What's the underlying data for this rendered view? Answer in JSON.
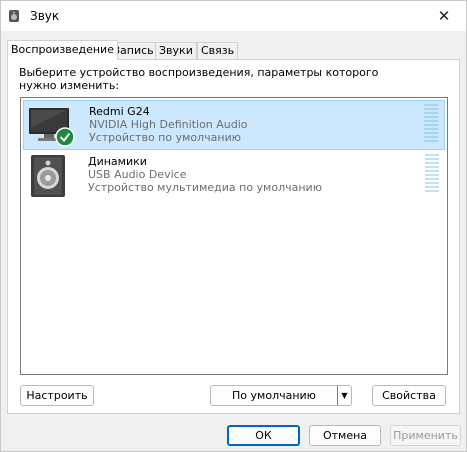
{
  "window": {
    "title": "Звук",
    "close_icon": "close-icon"
  },
  "tabs": [
    {
      "label": "Воспроизведение",
      "active": true
    },
    {
      "label": "Запись",
      "active": false
    },
    {
      "label": "Звуки",
      "active": false
    },
    {
      "label": "Связь",
      "active": false
    }
  ],
  "panel": {
    "instruction": "Выберите устройство воспроизведения, параметры которого нужно изменить:"
  },
  "devices": [
    {
      "name": "Redmi G24",
      "description": "NVIDIA High Definition Audio",
      "status": "Устройство по умолчанию",
      "icon": "monitor-icon",
      "selected": true,
      "default_badge": "checkmark-icon"
    },
    {
      "name": "Динамики",
      "description": "USB Audio Device",
      "status": "Устройство мультимедиа по умолчанию",
      "icon": "speaker-icon",
      "selected": false
    }
  ],
  "buttons": {
    "configure": "Настроить",
    "set_default": "По умолчанию",
    "properties": "Свойства",
    "ok": "ОК",
    "cancel": "Отмена",
    "apply": "Применить"
  },
  "colors": {
    "selection_bg": "#cce8ff",
    "selection_border": "#99d1ff",
    "accent": "#0067c0",
    "badge_green": "#1b8a3c"
  }
}
